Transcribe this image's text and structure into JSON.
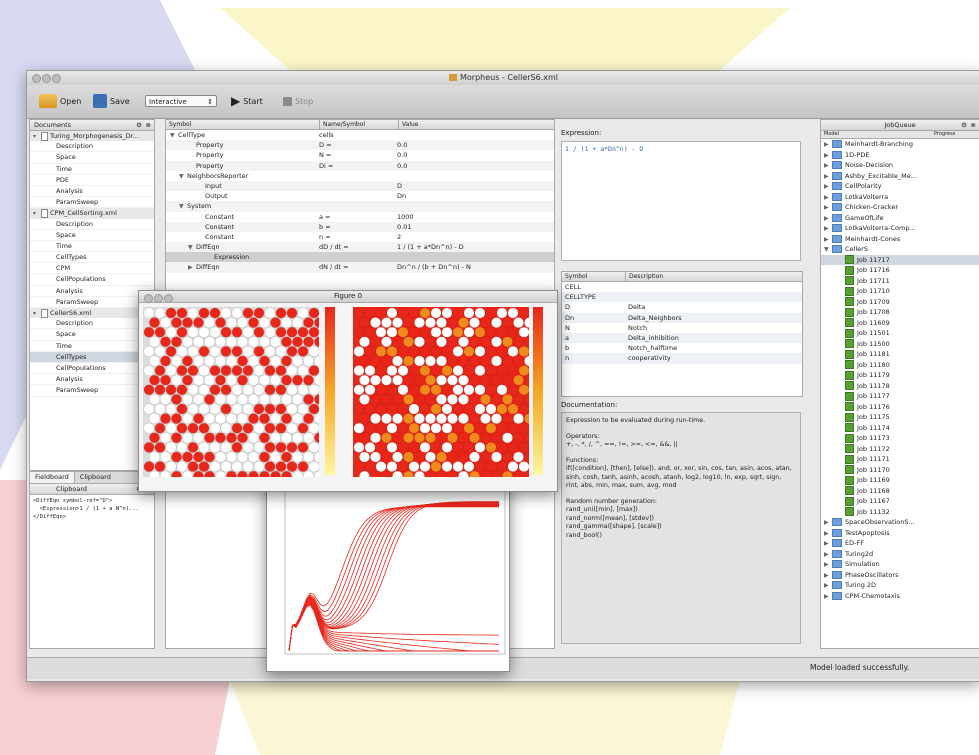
{
  "window": {
    "title": "Morpheus - CellerS6.xml"
  },
  "toolbar": {
    "open_label": "Open",
    "save_label": "Save",
    "mode_value": "Interactive",
    "start_label": "Start",
    "stop_label": "Stop"
  },
  "documents": {
    "header": "Documents",
    "files": [
      {
        "name": "Turing_Morphogenesis_Dr...",
        "sections": [
          "Description",
          "Space",
          "Time",
          "PDE",
          "Analysis",
          "ParamSweep"
        ]
      },
      {
        "name": "CPM_CellSorting.xml",
        "sections": [
          "Description",
          "Space",
          "Time",
          "CellTypes",
          "CPM",
          "CellPopulations",
          "Analysis",
          "ParamSweep"
        ]
      },
      {
        "name": "CellerS6.xml",
        "sections": [
          "Description",
          "Space",
          "Time",
          "CellTypes",
          "CellPopulations",
          "Analysis",
          "ParamSweep"
        ]
      }
    ]
  },
  "clipboard": {
    "tabs": [
      "Fieldboard",
      "Clipboard"
    ],
    "header": "Clipboard",
    "lines": [
      "<DiffEqn symbol-ref=\"D\">",
      "  <Expression>1 / (1 + a N^n)...",
      "</DiffEqn>"
    ]
  },
  "editor": {
    "columns": [
      "Symbol",
      "Name/Symbol",
      "Value"
    ],
    "rows": [
      {
        "indent": 0,
        "arrow": "▼",
        "a": "CellType",
        "b": "cells",
        "c": ""
      },
      {
        "indent": 2,
        "arrow": "",
        "a": "Property",
        "b": "D =",
        "c": "0.0"
      },
      {
        "indent": 2,
        "arrow": "",
        "a": "Property",
        "b": "N =",
        "c": "0.0"
      },
      {
        "indent": 2,
        "arrow": "",
        "a": "Property",
        "b": "Di =",
        "c": "0.0"
      },
      {
        "indent": 1,
        "arrow": "▼",
        "a": "NeighborsReporter",
        "b": "",
        "c": ""
      },
      {
        "indent": 3,
        "arrow": "",
        "a": "Input",
        "b": "",
        "c": "D"
      },
      {
        "indent": 3,
        "arrow": "",
        "a": "Output",
        "b": "",
        "c": "Dn"
      },
      {
        "indent": 1,
        "arrow": "▼",
        "a": "System",
        "b": "",
        "c": ""
      },
      {
        "indent": 3,
        "arrow": "",
        "a": "Constant",
        "b": "a =",
        "c": "1000"
      },
      {
        "indent": 3,
        "arrow": "",
        "a": "Constant",
        "b": "b =",
        "c": "0.01"
      },
      {
        "indent": 3,
        "arrow": "",
        "a": "Constant",
        "b": "n =",
        "c": "2"
      },
      {
        "indent": 2,
        "arrow": "▼",
        "a": "DiffEqn",
        "b": "dD / dt =",
        "c": "1 / (1 + a*Dn^n) - D"
      },
      {
        "indent": 4,
        "arrow": "",
        "a": "Expression",
        "b": "",
        "c": ""
      },
      {
        "indent": 2,
        "arrow": "▶",
        "a": "DiffEqn",
        "b": "dN / dt =",
        "c": "Dn^n / (b + Dn^n) - N"
      }
    ]
  },
  "expression": {
    "label": "Expression:",
    "value": "1 / (1 + a*Dn^n) - D"
  },
  "symbols": {
    "columns": [
      "Symbol",
      "Description"
    ],
    "rows": [
      {
        "s": "CELL",
        "d": ""
      },
      {
        "s": "CELLTYPE",
        "d": ""
      },
      {
        "s": "D",
        "d": "Delta"
      },
      {
        "s": "Dn",
        "d": "Delta_Neighbors"
      },
      {
        "s": "N",
        "d": "Notch"
      },
      {
        "s": "a",
        "d": "Delta_inhibition"
      },
      {
        "s": "b",
        "d": "Notch_halftime"
      },
      {
        "s": "n",
        "d": "cooperativity"
      }
    ]
  },
  "documentation": {
    "label": "Documentation:",
    "intro": "Expression to be evaluated during run-time.",
    "operators_title": "Operators:",
    "operators": "+, -, *, /, ^, ==, !=, >=, <=, &&, ||",
    "functions_title": "Functions:",
    "functions": "if([condition], [then], [else]), and, or, xor, sin, cos, tan, asin, acos, atan, sinh, cosh, tanh, asinh, acosh, atanh, log2, log10, ln, exp, sqrt, sign, rint, abs, min, max, sum, avg, mod",
    "random_title": "Random number generation:",
    "random": [
      "rand_uni([min], [max])",
      "rand_norm([mean], [stdev])",
      "rand_gamma([shape], [scale])",
      "rand_bool()"
    ]
  },
  "jobqueue": {
    "header": "JobQueue",
    "columns": [
      "Model",
      "Progress"
    ],
    "folders_top": [
      "Meinhardt-Branching",
      "1D-PDE",
      "Noise-Decision",
      "Ashby_Excitable_Me...",
      "CellPolarity",
      "LotkaVolterra",
      "Chicken-Cracker",
      "GameOfLife",
      "LotkaVolterra-Comp...",
      "Meinhardt-Cones"
    ],
    "open_folder": "CellerS",
    "jobs": [
      "Job 11717",
      "Job 11716",
      "Job 11711",
      "Job 11710",
      "Job 11709",
      "Job 11708",
      "Job 11609",
      "Job 11501",
      "Job 11500",
      "Job 11181",
      "Job 11180",
      "Job 11179",
      "Job 11178",
      "Job 11177",
      "Job 11176",
      "Job 11175",
      "Job 11174",
      "Job 11173",
      "Job 11172",
      "Job 11171",
      "Job 11170",
      "Job 11169",
      "Job 11168",
      "Job 11167",
      "Job 11132"
    ],
    "folders_bottom": [
      "SpaceObservationS...",
      "TestApoptosis",
      "ED-FF",
      "Turing2d",
      "Simulation",
      "PhaseOscillators",
      "Turing 2D",
      "CPM-Chemotaxis"
    ]
  },
  "status": {
    "message": "Model loaded successfully."
  },
  "figure": {
    "title": "Figure 0"
  },
  "colors": {
    "accent": "#e8261a",
    "cell_white": "#ffffff",
    "cell_orange": "#f08a1c",
    "grid_bg": "#dcdcdc"
  },
  "chart_data": {
    "type": "line",
    "title": "",
    "xlabel": "",
    "ylabel": "",
    "series_count": 22,
    "description_values": {
      "rising_to": 1.0,
      "decay_to": 0.0
    }
  }
}
